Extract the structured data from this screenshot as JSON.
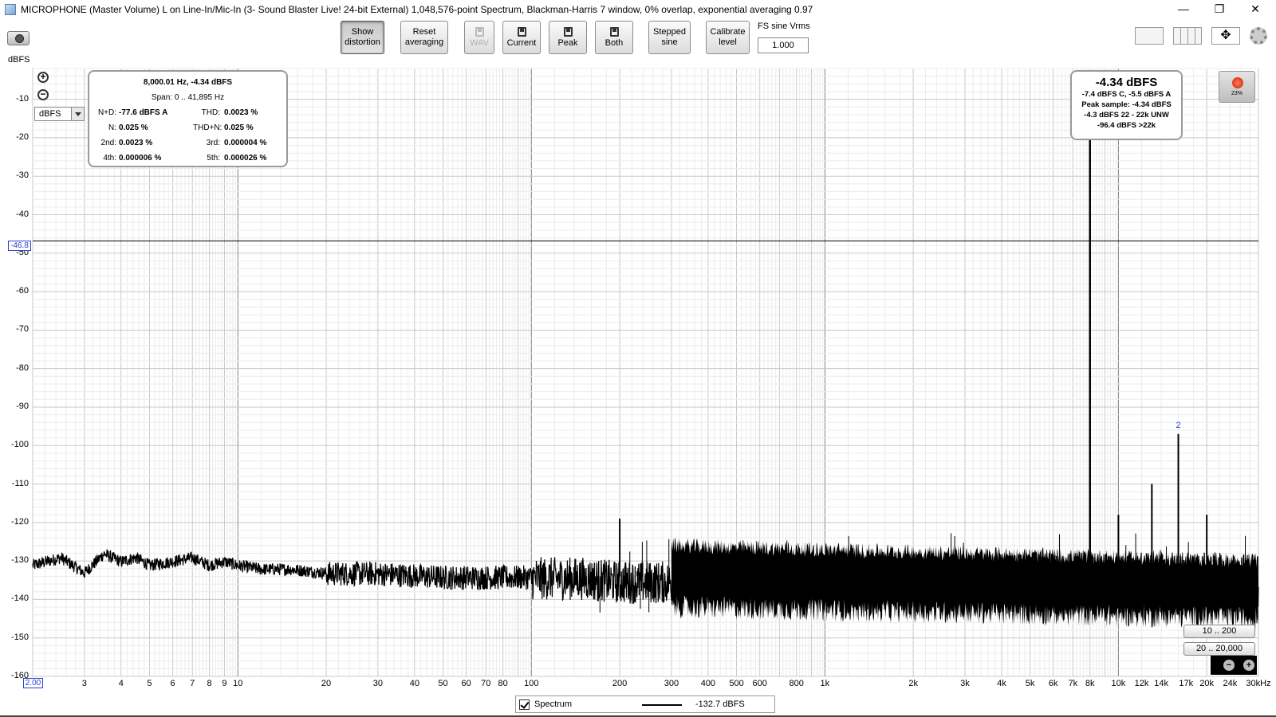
{
  "window": {
    "title": "MICROPHONE (Master Volume) L on Line-In/Mic-In (3- Sound Blaster Live! 24-bit External) 1,048,576-point Spectrum, Blackman-Harris 7 window, 0% overlap, exponential averaging 0.97",
    "minimize": "—",
    "restore": "❐",
    "close": "✕"
  },
  "toolbar": {
    "show_distortion": [
      "Show",
      "distortion"
    ],
    "reset_averaging": [
      "Reset",
      "averaging"
    ],
    "wav": "WAV",
    "current": "Current",
    "peak": "Peak",
    "both": "Both",
    "stepped_sine": [
      "Stepped",
      "sine"
    ],
    "calibrate_level": [
      "Calibrate",
      "level"
    ],
    "fs_label": "FS sine Vrms",
    "fs_value": "1.000"
  },
  "plot": {
    "unit_label": "dBFS",
    "unit_select": "dBFS",
    "x_start_label": "2.00",
    "cursor_label": "-46.8"
  },
  "distortion_panel": {
    "header": "8,000.01 Hz, -4.34 dBFS",
    "span": "Span: 0 .. 41,895 Hz",
    "rows": [
      {
        "l1": "N+D:",
        "v1": "-77.6 dBFS A",
        "l2": "THD:",
        "v2": "0.0023 %"
      },
      {
        "l1": "N:",
        "v1": "0.025 %",
        "l2": "THD+N:",
        "v2": "0.025 %"
      },
      {
        "l1": "2nd:",
        "v1": "0.0023 %",
        "l2": "3rd:",
        "v2": "0.000004 %"
      },
      {
        "l1": "4th:",
        "v1": "0.000006 %",
        "l2": "5th:",
        "v2": "0.000026 %"
      }
    ]
  },
  "peak_panel": {
    "main": "-4.34 dBFS",
    "line1": "-7.4 dBFS C, -5.5 dBFS A",
    "line2": "Peak sample: -4.34 dBFS",
    "line3": "-4.3 dBFS 22 - 22k UNW",
    "line4": "-96.4 dBFS >22k"
  },
  "record": {
    "percent": "23%"
  },
  "ranges": {
    "r1": "10 .. 200",
    "r2": "20 .. 20,000"
  },
  "legend": {
    "name": "Spectrum",
    "value": "-132.7 dBFS"
  },
  "colors": {
    "trace": "#000000",
    "grid_minor": "#d8d8d8",
    "grid_major": "#808080",
    "accent": "#2a3fd6",
    "record": "#e0300e"
  },
  "chart_data": {
    "type": "line",
    "title": "",
    "xlabel": "",
    "ylabel": "dBFS",
    "xscale": "log",
    "xlim": [
      2,
      30000
    ],
    "ylim": [
      -160,
      -2
    ],
    "grid": true,
    "yticks": [
      -10,
      -20,
      -30,
      -40,
      -50,
      -60,
      -70,
      -80,
      -90,
      -100,
      -110,
      -120,
      -130,
      -140,
      -150,
      -160
    ],
    "xticks": [
      {
        "v": 3,
        "t": "3"
      },
      {
        "v": 4,
        "t": "4"
      },
      {
        "v": 5,
        "t": "5"
      },
      {
        "v": 6,
        "t": "6"
      },
      {
        "v": 7,
        "t": "7"
      },
      {
        "v": 8,
        "t": "8"
      },
      {
        "v": 9,
        "t": "9"
      },
      {
        "v": 10,
        "t": "10"
      },
      {
        "v": 20,
        "t": "20"
      },
      {
        "v": 30,
        "t": "30"
      },
      {
        "v": 40,
        "t": "40"
      },
      {
        "v": 50,
        "t": "50"
      },
      {
        "v": 60,
        "t": "60"
      },
      {
        "v": 70,
        "t": "70"
      },
      {
        "v": 80,
        "t": "80"
      },
      {
        "v": 100,
        "t": "100"
      },
      {
        "v": 200,
        "t": "200"
      },
      {
        "v": 300,
        "t": "300"
      },
      {
        "v": 400,
        "t": "400"
      },
      {
        "v": 500,
        "t": "500"
      },
      {
        "v": 600,
        "t": "600"
      },
      {
        "v": 800,
        "t": "800"
      },
      {
        "v": 1000,
        "t": "1k"
      },
      {
        "v": 2000,
        "t": "2k"
      },
      {
        "v": 3000,
        "t": "3k"
      },
      {
        "v": 4000,
        "t": "4k"
      },
      {
        "v": 5000,
        "t": "5k"
      },
      {
        "v": 6000,
        "t": "6k"
      },
      {
        "v": 7000,
        "t": "7k"
      },
      {
        "v": 8000,
        "t": "8k"
      },
      {
        "v": 10000,
        "t": "10k"
      },
      {
        "v": 12000,
        "t": "12k"
      },
      {
        "v": 14000,
        "t": "14k"
      },
      {
        "v": 17000,
        "t": "17k"
      },
      {
        "v": 20000,
        "t": "20k"
      },
      {
        "v": 24000,
        "t": "24k"
      },
      {
        "v": 30000,
        "t": "30kHz"
      }
    ],
    "cursor_db": -46.8,
    "series": [
      {
        "name": "Spectrum",
        "x": [
          2,
          2.5,
          3,
          3.5,
          4,
          4.5,
          5,
          6,
          7,
          8,
          9,
          10,
          12,
          15,
          20,
          30,
          50,
          100,
          150,
          200,
          300,
          500,
          700,
          1000,
          1500,
          2000,
          3000,
          4000,
          5000,
          6000,
          7000,
          7800,
          8000,
          8200,
          9000,
          10000,
          12000,
          14000,
          16000,
          18000,
          20000,
          22000,
          24000,
          28000,
          30000
        ],
        "y": [
          -131,
          -129,
          -133,
          -128,
          -130,
          -129,
          -131,
          -130,
          -129,
          -131,
          -130,
          -131,
          -132,
          -132,
          -133,
          -133,
          -134,
          -134,
          -134,
          -135,
          -135,
          -135,
          -135,
          -135,
          -135,
          -135,
          -135,
          -135,
          -135,
          -135,
          -135,
          -135,
          -4.34,
          -135,
          -135,
          -135,
          -135,
          -135,
          -135,
          -135,
          -135,
          -135,
          -135,
          -135,
          -135
        ]
      }
    ],
    "peaks": [
      {
        "x": 8000,
        "y": -4.34
      },
      {
        "x": 16000,
        "y": -97,
        "label": "2"
      },
      {
        "x": 13000,
        "y": -110
      },
      {
        "x": 200,
        "y": -119
      },
      {
        "x": 10000,
        "y": -118
      },
      {
        "x": 20000,
        "y": -118
      }
    ],
    "noise_band": {
      "top": -130,
      "bottom": -142
    }
  }
}
